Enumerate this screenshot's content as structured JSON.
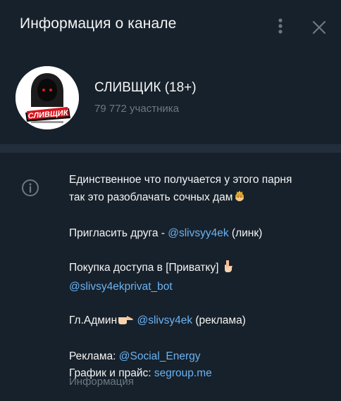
{
  "header": {
    "title": "Информация о канале"
  },
  "channel": {
    "name": "СЛИВЩИК (18+)",
    "subscribers": "79 772 участника",
    "avatar_logo_text": "СЛИВЩИК"
  },
  "description": {
    "line1": "Единственное что получается у этого парня",
    "line2": "так это разоблачать сочных дам",
    "invite_prefix": "Пригласить друга - ",
    "invite_link": "@slivsyy4ek",
    "invite_suffix": " (линк)",
    "purchase_text": "Покупка доступа в [Приватку] ",
    "purchase_link": "@slivsy4ekprivat_bot",
    "admin_prefix": "Гл.Админ",
    "admin_link": "@slivsy4ek",
    "admin_suffix": " (реклама)",
    "ads_prefix": "Реклама: ",
    "ads_link": "@Social_Energy",
    "price_prefix": "График и прайс: ",
    "price_link": "segroup.me"
  },
  "caption": "Информация",
  "icons": {
    "more": "more-vertical-icon",
    "close": "close-icon",
    "info": "info-icon",
    "princess_emoji": "princess-emoji",
    "point_down_emoji": "point-down-emoji",
    "point_right_emoji": "point-right-emoji"
  },
  "colors": {
    "background": "#17212b",
    "divider": "#232e3c",
    "link": "#6ab3f3",
    "muted": "#6c7883",
    "text": "#f5f5f5"
  }
}
